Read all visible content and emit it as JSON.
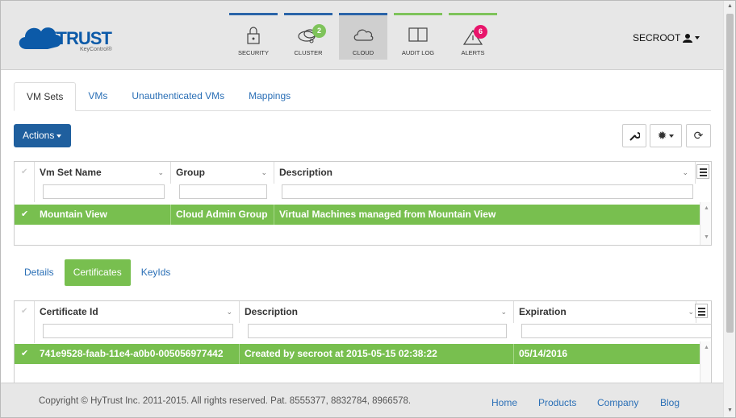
{
  "brand": {
    "name": "HYTRUST",
    "sub": "KeyControl®"
  },
  "nav": [
    {
      "label": "SECURITY",
      "icon": "lock-icon"
    },
    {
      "label": "CLUSTER",
      "icon": "cluster-icon",
      "badge": "2"
    },
    {
      "label": "CLOUD",
      "icon": "cloud-icon",
      "active": true
    },
    {
      "label": "AUDIT LOG",
      "icon": "book-icon"
    },
    {
      "label": "ALERTS",
      "icon": "warning-icon",
      "badge": "6"
    }
  ],
  "user": {
    "name": "SECROOT"
  },
  "tabs": [
    "VM Sets",
    "VMs",
    "Unauthenticated VMs",
    "Mappings"
  ],
  "actions_label": "Actions",
  "vmsets_grid": {
    "columns": [
      "Vm Set Name",
      "Group",
      "Description"
    ],
    "rows": [
      {
        "name": "Mountain View",
        "group": "Cloud Admin Group",
        "description": "Virtual Machines managed from Mountain View",
        "selected": true
      }
    ]
  },
  "subtabs": [
    "Details",
    "Certificates",
    "KeyIds"
  ],
  "cert_grid": {
    "columns": [
      "Certificate Id",
      "Description",
      "Expiration"
    ],
    "rows": [
      {
        "id": "741e9528-faab-11e4-a0b0-005056977442",
        "description": "Created by secroot at 2015-05-15 02:38:22",
        "expiration": "05/14/2016",
        "selected": true
      }
    ]
  },
  "footer": {
    "copyright": "Copyright © HyTrust Inc. 2011-2015. All rights reserved. Pat. 8555377, 8832784, 8966578.",
    "links": [
      "Home",
      "Products",
      "Company",
      "Blog"
    ]
  },
  "colors": {
    "brand_blue": "#1f5f9e",
    "selected_green": "#78bf4f",
    "alert_pink": "#e8156b"
  }
}
